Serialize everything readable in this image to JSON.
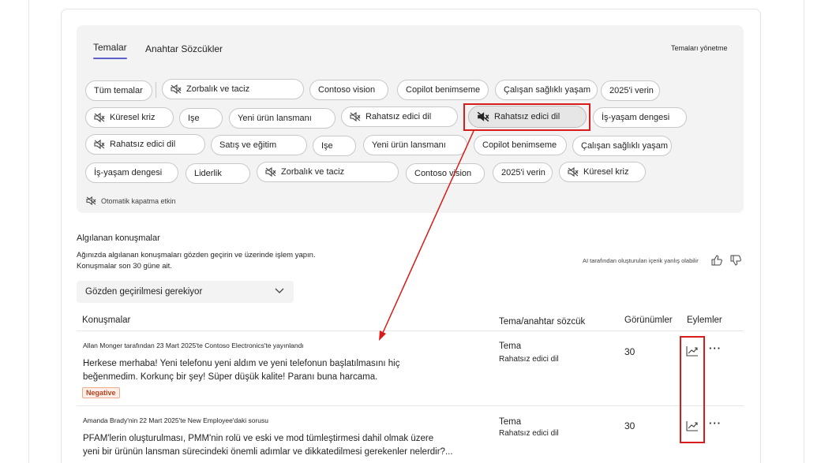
{
  "tabs": {
    "themes": "Temalar",
    "keywords": "Anahtar Sözcükler",
    "manage": "Temaları yönetme"
  },
  "chips": [
    {
      "label": "Tüm temalar",
      "muted": false
    },
    {
      "label": "Zorbalık ve taciz",
      "muted": true
    },
    {
      "label": "Contoso vision",
      "muted": false
    },
    {
      "label": "Copilot benimseme",
      "muted": false
    },
    {
      "label": "Çalışan sağlıklı yaşam",
      "muted": false
    },
    {
      "label": "2025'i verin",
      "muted": false
    },
    {
      "label": "Küresel kriz",
      "muted": true
    },
    {
      "label": "Işe",
      "muted": false
    },
    {
      "label": "Yeni ürün lansmanı",
      "muted": false
    },
    {
      "label": "Rahatsız edici dil",
      "muted": true
    },
    {
      "label": "Rahatsız edici dil",
      "muted": true,
      "selected": true
    },
    {
      "label": "İş-yaşam dengesi",
      "muted": false
    },
    {
      "label": "Rahatsız edici dil",
      "muted": true
    },
    {
      "label": "Satış ve eğitim",
      "muted": false
    },
    {
      "label": "Işe",
      "muted": false
    },
    {
      "label": "Yeni ürün lansmanı",
      "muted": false
    },
    {
      "label": "Copilot benimseme",
      "muted": false
    },
    {
      "label": "Çalışan sağlıklı yaşam",
      "muted": false
    },
    {
      "label": "İş-yaşam dengesi",
      "muted": false
    },
    {
      "label": "Liderlik",
      "muted": false
    },
    {
      "label": "Zorbalık ve taciz",
      "muted": true
    },
    {
      "label": "Contoso vision",
      "muted": false
    },
    {
      "label": "2025'i verin",
      "muted": false
    },
    {
      "label": "Küresel kriz",
      "muted": true
    }
  ],
  "auto_mute": "Otomatik kapatma etkin",
  "section": {
    "title": "Algılanan konuşmalar",
    "desc_line1": "Ağınızda algılanan konuşmaları gözden geçirin ve üzerinde işlem yapın.",
    "desc_line2": "Konuşmalar son 30 güne ait.",
    "ai_note": "AI tarafından oluşturulan içerik yanlış olabilir"
  },
  "filter": {
    "selected": "Gözden geçirilmesi gerekiyor"
  },
  "columns": {
    "conversations": "Konuşmalar",
    "theme": "Tema/anahtar sözcük",
    "views": "Görünümler",
    "actions": "Eylemler"
  },
  "rows": [
    {
      "meta": "Allan Monger tarafından 23 Mart 2025'te Contoso Electronics'te yayınlandı",
      "line1": "Herkese merhaba! Yeni telefonu yeni aldım ve yeni telefonun başlatılmasını hiç",
      "line2": "beğenmedim. Korkunç bir şey! Süper düşük kalite! Paranı buna harcama.",
      "badge": "Negative",
      "theme": "Tema",
      "theme_sub": "Rahatsız edici dil",
      "views": "30"
    },
    {
      "meta": "Amanda Brady'nin 22 Mart 2025'te New Employee'daki sorusu",
      "line1": "PFAM'lerin oluşturulması, PMM'nin rolü ve eski ve mod tümleştirmesi dahil olmak üzere",
      "line2": "yeni bir ürünün lansman sürecindeki önemli adımlar ve dikkatedilmesi gerekenler nelerdir?...",
      "theme": "Tema",
      "theme_sub": "Rahatsız edici dil",
      "views": "30"
    }
  ],
  "colors": {
    "accent": "#5b5fc7",
    "annotation": "#d81b1b",
    "negative": "#b5431d"
  },
  "icons": [
    "mute-icon",
    "chevron-down-icon",
    "thumbs-up-icon",
    "thumbs-down-icon",
    "trend-icon",
    "more-icon"
  ]
}
